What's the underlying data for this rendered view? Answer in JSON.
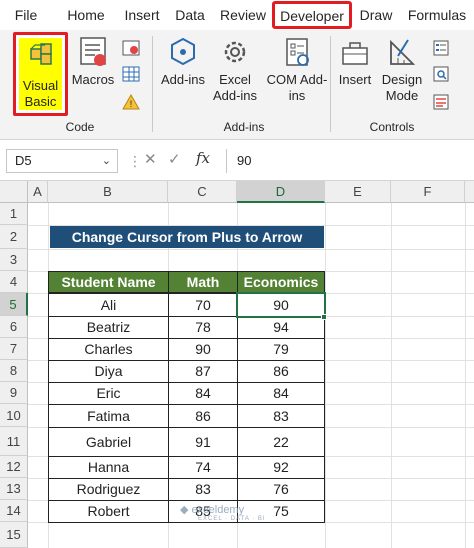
{
  "menu": {
    "tabs": [
      {
        "label": "File"
      },
      {
        "label": "Home"
      },
      {
        "label": "Insert"
      },
      {
        "label": "Data"
      },
      {
        "label": "Review"
      },
      {
        "label": "Developer"
      },
      {
        "label": "Draw"
      },
      {
        "label": "Formulas"
      }
    ]
  },
  "ribbon": {
    "code": {
      "label": "Code",
      "visual_basic": "Visual Basic",
      "macros": "Macros"
    },
    "addins": {
      "label": "Add-ins",
      "addins_btn": "Add-ins",
      "excel_addins": "Excel Add-ins",
      "com_addins": "COM Add-ins"
    },
    "controls": {
      "label": "Controls",
      "insert": "Insert",
      "design_mode": "Design Mode"
    },
    "colors": {
      "highlight_border": "#e31b23",
      "vb_fill": "#ffff00",
      "icon_blue": "#2b6cb0"
    }
  },
  "formula_bar": {
    "name_box": "D5",
    "fx": "fx",
    "value": "90"
  },
  "sheet": {
    "columns": [
      "A",
      "B",
      "C",
      "D",
      "E",
      "F"
    ],
    "rows": [
      "1",
      "2",
      "3",
      "4",
      "5",
      "6",
      "7",
      "8",
      "9",
      "10",
      "11",
      "12",
      "13",
      "14",
      "15"
    ],
    "title": "Change Cursor from Plus to Arrow",
    "headers": [
      "Student Name",
      "Math",
      "Economics"
    ],
    "data": [
      [
        "Ali",
        "70",
        "90"
      ],
      [
        "Beatriz",
        "78",
        "94"
      ],
      [
        "Charles",
        "90",
        "79"
      ],
      [
        "Diya",
        "87",
        "86"
      ],
      [
        "Eric",
        "84",
        "84"
      ],
      [
        "Fatima",
        "86",
        "83"
      ],
      [
        "Gabriel",
        "91",
        "22"
      ],
      [
        "Hanna",
        "74",
        "92"
      ],
      [
        "Rodriguez",
        "83",
        "76"
      ],
      [
        "Robert",
        "85",
        "75"
      ]
    ],
    "colors": {
      "title_bg": "#1f4e79",
      "header_bg": "#548235",
      "select": "#217346"
    }
  },
  "watermark": {
    "brand": "exceldemy",
    "tagline": "EXCEL · DATA · BI"
  }
}
